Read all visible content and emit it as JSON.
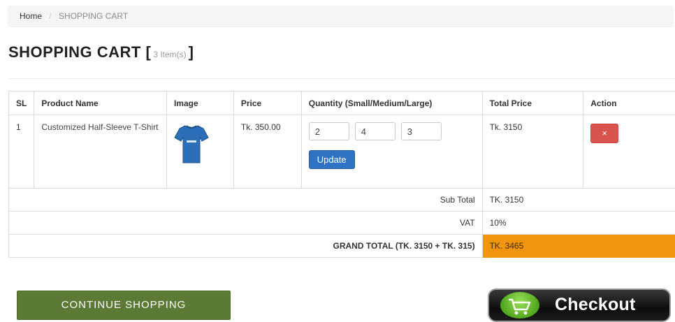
{
  "breadcrumb": {
    "home": "Home",
    "separator": "/",
    "current": "SHOPPING CART"
  },
  "title": {
    "text": "SHOPPING CART",
    "bracket_open": "[",
    "count": "3 Item(s)",
    "bracket_close": "]"
  },
  "table": {
    "headers": [
      "SL",
      "Product Name",
      "Image",
      "Price",
      "Quantity (Small/Medium/Large)",
      "Total Price",
      "Action"
    ],
    "items": [
      {
        "sl": "1",
        "name": "Customized Half-Sleeve T-Shirt",
        "image": "blue-tshirt",
        "price": "Tk. 350.00",
        "qty_small": "2",
        "qty_medium": "4",
        "qty_large": "3",
        "update_label": "Update",
        "total": "Tk. 3150",
        "remove_label": "×"
      }
    ],
    "subtotal_label": "Sub Total",
    "subtotal_value": "TK. 3150",
    "vat_label": "VAT",
    "vat_value": "10%",
    "grand_label": "GRAND TOTAL (TK. 3150 + TK. 315)",
    "grand_value": "TK. 3465"
  },
  "actions": {
    "continue_label": "CONTINUE SHOPPING",
    "checkout_label": "Checkout"
  },
  "colors": {
    "grand_total_bg": "#f2950e",
    "update_button": "#2e73c4",
    "remove_button": "#d9534f",
    "continue_button": "#5b7a36"
  }
}
